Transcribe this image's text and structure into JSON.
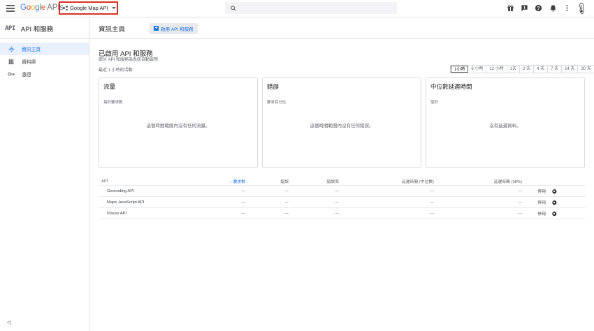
{
  "header": {
    "logo_google": "Google",
    "logo_apis": "APIs",
    "project_name": "Google Map API",
    "search_placeholder": "",
    "icons": [
      "gift-icon",
      "chat-icon",
      "help-icon",
      "notifications-icon",
      "more-vert-icon",
      "avatar"
    ]
  },
  "nav": {
    "badge": "API",
    "title": "API 和服務",
    "items": [
      {
        "label": "資訊主頁",
        "icon": "dashboard-icon",
        "active": true
      },
      {
        "label": "資料庫",
        "icon": "library-icon",
        "active": false
      },
      {
        "label": "憑證",
        "icon": "key-icon",
        "active": false
      }
    ],
    "collapse": "<|"
  },
  "page": {
    "title": "資訊主頁",
    "enable_button": "啟用 API 和服務"
  },
  "main": {
    "section_title": "已啟用 API 和服務",
    "section_sub": "部分 API 和服務為系統自動啟用",
    "recent_label": "最近 1 小時的活動",
    "time_ranges": [
      "1小時",
      "6 小時",
      "12 小時",
      "1天",
      "2 天",
      "4 天",
      "7 天",
      "14 天",
      "30 天"
    ],
    "selected_range": 0,
    "cards": [
      {
        "title": "流量",
        "sub": "每秒要求數",
        "empty": "這個時間範圍內沒有任何流量。"
      },
      {
        "title": "錯誤",
        "sub": "要求百分比",
        "empty": "這個時間範圍內沒有任何錯誤。"
      },
      {
        "title": "中位數延遲時間",
        "sub": "毫秒",
        "empty": "沒有延遲資料。"
      }
    ],
    "table": {
      "headers": {
        "api": "API",
        "requests": "要求數",
        "errors": "錯誤",
        "error_rate": "錯誤率",
        "latency_median": "延遲時間 (中位數)",
        "latency_98": "延遲時間 (98%)"
      },
      "rows": [
        {
          "name": "Geocoding API",
          "requests": "—",
          "errors": "—",
          "error_rate": "—",
          "latency_median": "—",
          "latency_98": "—",
          "disable": "停用"
        },
        {
          "name": "Maps JavaScript API",
          "requests": "—",
          "errors": "—",
          "error_rate": "—",
          "latency_median": "—",
          "latency_98": "—",
          "disable": "停用"
        },
        {
          "name": "Places API",
          "requests": "—",
          "errors": "—",
          "error_rate": "—",
          "latency_median": "—",
          "latency_98": "—",
          "disable": "停用"
        }
      ]
    }
  },
  "colors": {
    "accent": "#1a73e8",
    "highlight_border": "#d93025"
  }
}
